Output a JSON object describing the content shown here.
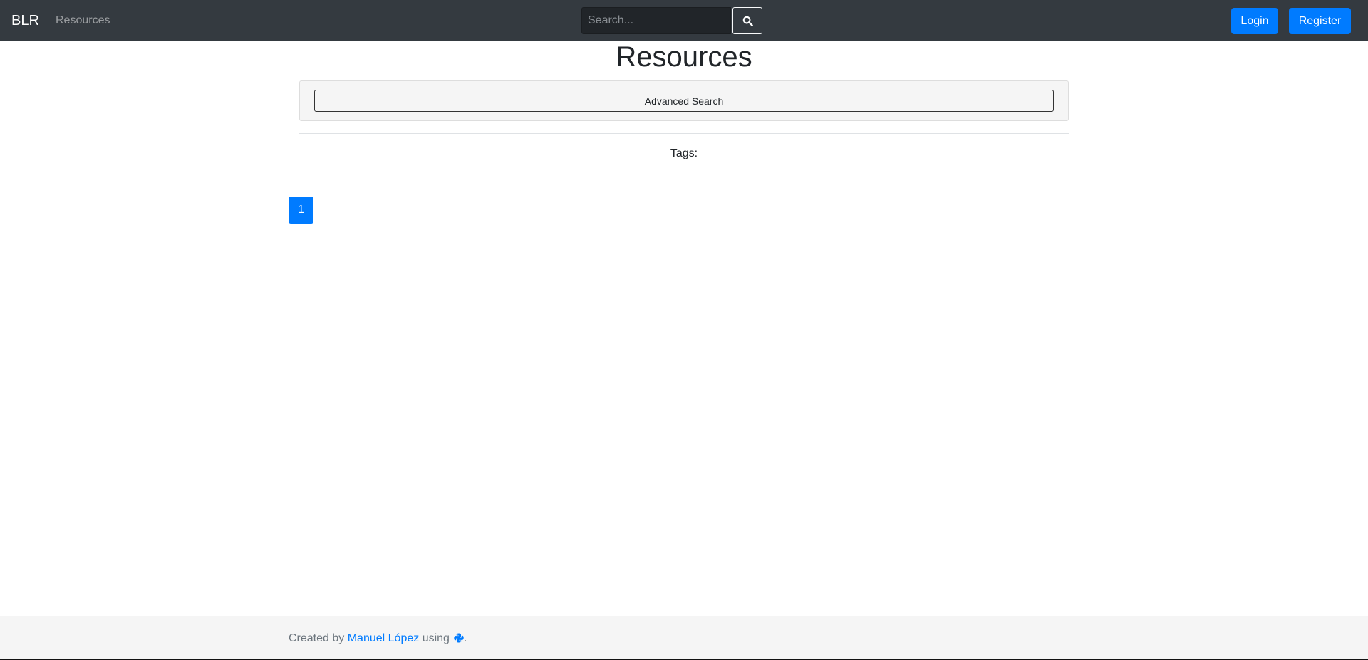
{
  "navbar": {
    "brand": "BLR",
    "nav_link": "Resources",
    "search_placeholder": "Search...",
    "search_icon": "search-icon",
    "login_label": "Login",
    "register_label": "Register"
  },
  "main": {
    "title": "Resources",
    "advanced_search_label": "Advanced Search",
    "tags_label": "Tags:",
    "pagination": [
      "1"
    ]
  },
  "footer": {
    "prefix": "Created by",
    "author": "Manuel López",
    "middle": "using",
    "tech_icon": "python-icon",
    "suffix": "."
  },
  "colors": {
    "navbar_bg": "#343a40",
    "primary": "#007bff",
    "footer_bg": "#f5f5f5",
    "footer_text": "#6c757d"
  }
}
